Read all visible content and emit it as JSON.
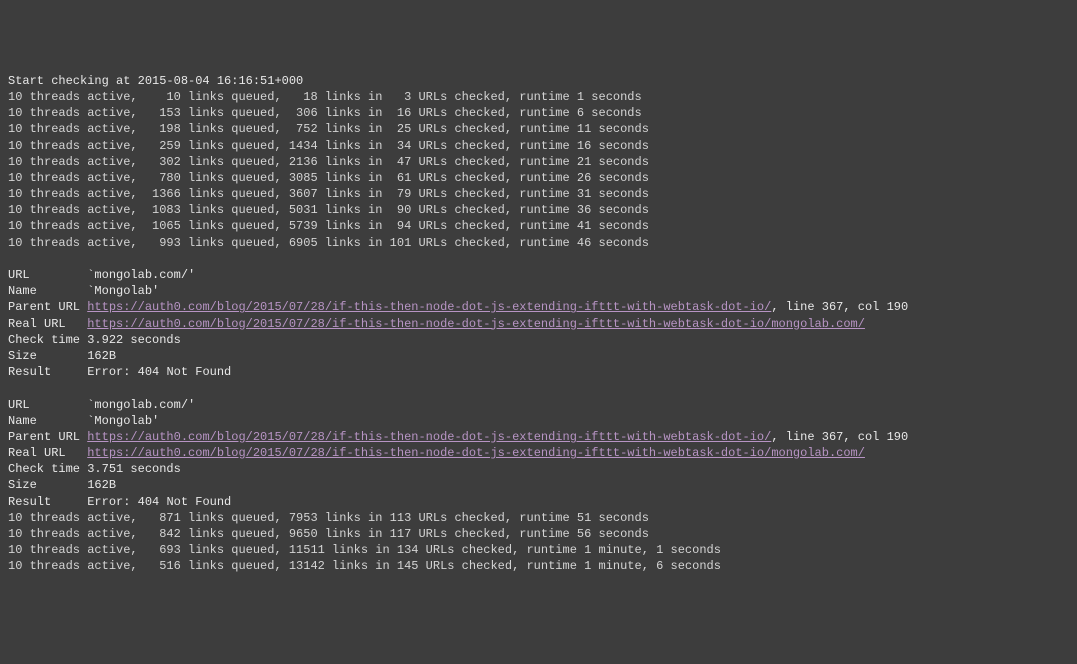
{
  "start_line": "Start checking at 2015-08-04 16:16:51+000",
  "progress_lines_1": [
    "10 threads active,    10 links queued,   18 links in   3 URLs checked, runtime 1 seconds",
    "10 threads active,   153 links queued,  306 links in  16 URLs checked, runtime 6 seconds",
    "10 threads active,   198 links queued,  752 links in  25 URLs checked, runtime 11 seconds",
    "10 threads active,   259 links queued, 1434 links in  34 URLs checked, runtime 16 seconds",
    "10 threads active,   302 links queued, 2136 links in  47 URLs checked, runtime 21 seconds",
    "10 threads active,   780 links queued, 3085 links in  61 URLs checked, runtime 26 seconds",
    "10 threads active,  1366 links queued, 3607 links in  79 URLs checked, runtime 31 seconds",
    "10 threads active,  1083 links queued, 5031 links in  90 URLs checked, runtime 36 seconds",
    "10 threads active,  1065 links queued, 5739 links in  94 URLs checked, runtime 41 seconds",
    "10 threads active,   993 links queued, 6905 links in 101 URLs checked, runtime 46 seconds"
  ],
  "result1": {
    "url_label": "URL",
    "url_value": "`mongolab.com/'",
    "name_label": "Name",
    "name_value": "`Mongolab'",
    "parent_label": "Parent URL",
    "parent_link": "https://auth0.com/blog/2015/07/28/if-this-then-node-dot-js-extending-ifttt-with-webtask-dot-io/",
    "parent_suffix": ", line 367, col 190",
    "real_label": "Real URL",
    "real_link": "https://auth0.com/blog/2015/07/28/if-this-then-node-dot-js-extending-ifttt-with-webtask-dot-io/mongolab.com/",
    "check_label": "Check time",
    "check_value": "3.922 seconds",
    "size_label": "Size",
    "size_value": "162B",
    "result_label": "Result",
    "result_value": "Error: 404 Not Found"
  },
  "result2": {
    "url_label": "URL",
    "url_value": "`mongolab.com/'",
    "name_label": "Name",
    "name_value": "`Mongolab'",
    "parent_label": "Parent URL",
    "parent_link": "https://auth0.com/blog/2015/07/28/if-this-then-node-dot-js-extending-ifttt-with-webtask-dot-io/",
    "parent_suffix": ", line 367, col 190",
    "real_label": "Real URL",
    "real_link": "https://auth0.com/blog/2015/07/28/if-this-then-node-dot-js-extending-ifttt-with-webtask-dot-io/mongolab.com/",
    "check_label": "Check time",
    "check_value": "3.751 seconds",
    "size_label": "Size",
    "size_value": "162B",
    "result_label": "Result",
    "result_value": "Error: 404 Not Found"
  },
  "progress_lines_2": [
    "10 threads active,   871 links queued, 7953 links in 113 URLs checked, runtime 51 seconds",
    "10 threads active,   842 links queued, 9650 links in 117 URLs checked, runtime 56 seconds",
    "10 threads active,   693 links queued, 11511 links in 134 URLs checked, runtime 1 minute, 1 seconds",
    "10 threads active,   516 links queued, 13142 links in 145 URLs checked, runtime 1 minute, 6 seconds"
  ]
}
